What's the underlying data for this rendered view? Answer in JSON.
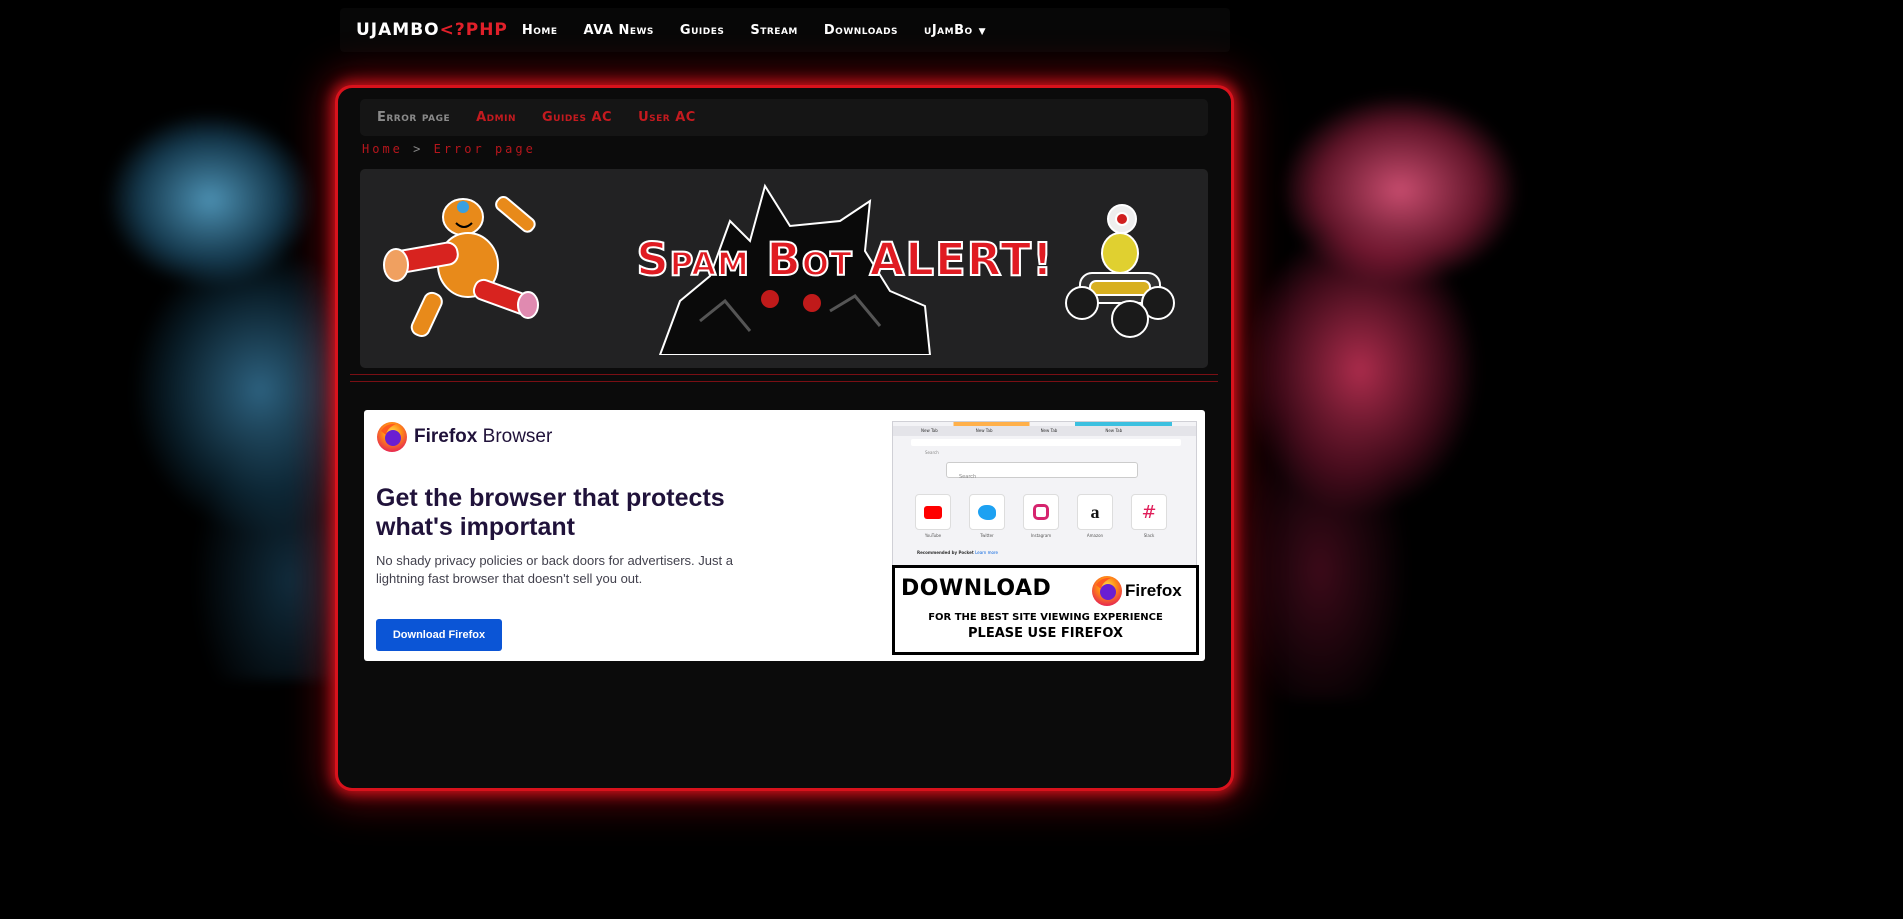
{
  "topnav": {
    "brand_main": "UJAMBO",
    "brand_accent": "<?PHP",
    "items": [
      {
        "label": "Home"
      },
      {
        "label": "AVA News"
      },
      {
        "label": "Guides"
      },
      {
        "label": "Stream"
      },
      {
        "label": "Downloads"
      },
      {
        "label": "uJamBo"
      }
    ]
  },
  "subnav": {
    "items": [
      {
        "label": "Error page"
      },
      {
        "label": "Admin"
      },
      {
        "label": "Guides AC"
      },
      {
        "label": "User AC"
      }
    ]
  },
  "breadcrumb": {
    "home": "Home",
    "separator": ">",
    "current": "Error page"
  },
  "banner": {
    "title": "Spam Bot ALERT!"
  },
  "ad": {
    "brand_bold": "Firefox",
    "brand_rest": "Browser",
    "headline": "Get the browser that protects what's important",
    "body": "No shady privacy policies or back doors for advertisers. Just a lightning fast browser that doesn't sell you out.",
    "button": "Download Firefox",
    "mock_tab_label": "New Tab",
    "mock_search_placeholder": "Search",
    "mock_shortcuts": [
      "YouTube",
      "Twitter",
      "Instagram",
      "Amazon",
      "Slack"
    ],
    "mock_pocket_label": "Recommended by Pocket",
    "mock_pocket_link": "Learn more",
    "download_word": "DOWNLOAD",
    "download_brand": "Firefox",
    "download_line1": "FOR THE BEST SITE VIEWING EXPERIENCE",
    "download_line2": "PLEASE USE FIREFOX"
  },
  "colors": {
    "accent_red": "#e0202a",
    "glow_red": "#d8121c",
    "firefox_blue": "#0b55d6"
  }
}
